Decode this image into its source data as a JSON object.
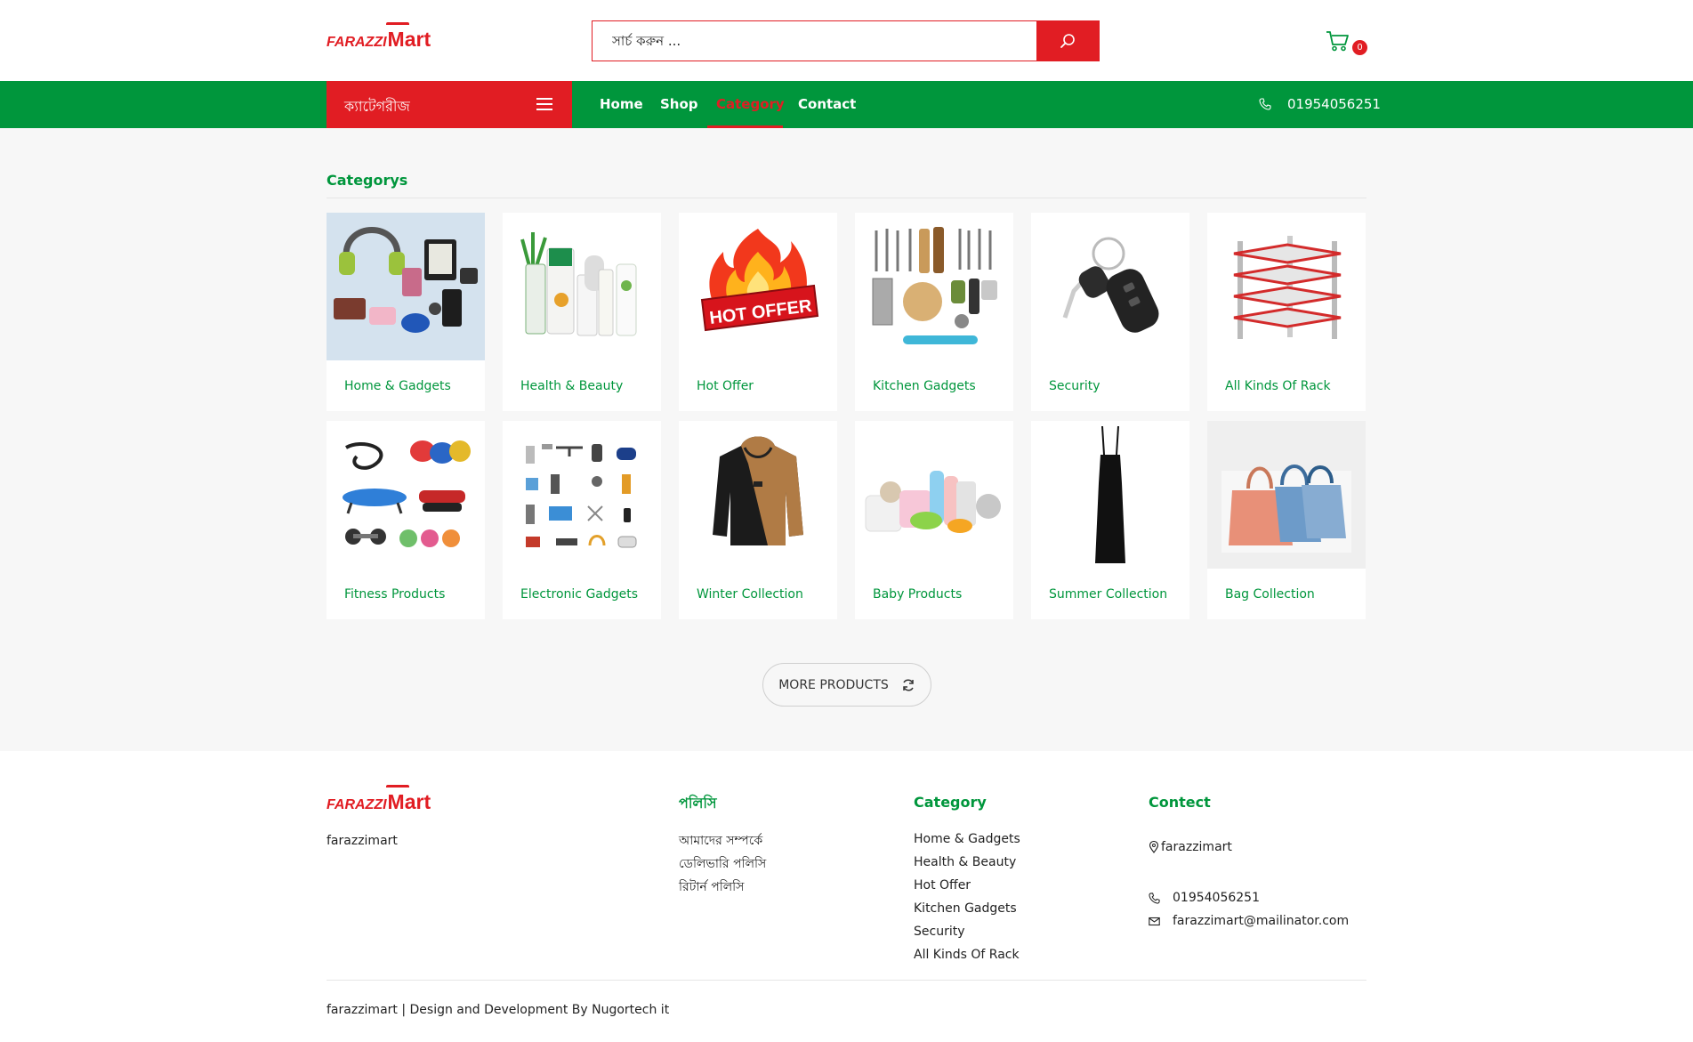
{
  "colors": {
    "brand_green": "#00963c",
    "brand_red": "#e11d23"
  },
  "header": {
    "logo_a": "FARAZZI",
    "logo_b": "Mart",
    "search_placeholder": "সার্চ করুন ...",
    "search_icon": "search-icon",
    "cart_icon": "cart-icon",
    "cart_count": "0"
  },
  "nav": {
    "categories_label": "ক্যাটেগরীজ",
    "links": [
      "Home",
      "Shop",
      "Category",
      "Contact"
    ],
    "active": "Category",
    "phone": "01954056251"
  },
  "main": {
    "title": "Categorys",
    "categories": [
      "Home & Gadgets",
      "Health & Beauty",
      "Hot Offer",
      "Kitchen Gadgets",
      "Security",
      "All Kinds Of Rack",
      "Fitness Products",
      "Electronic Gadgets",
      "Winter Collection",
      "Baby Products",
      "Summer Collection",
      "Bag Collection"
    ],
    "hot_offer_text": "HOT OFFER",
    "more_button": "MORE PRODUCTS"
  },
  "footer": {
    "about": "farazzimart",
    "policy_heading": "পলিসি",
    "policy_links": [
      "আমাদের সম্পর্কে",
      "ডেলিভারি পলিসি",
      "রিটার্ন পলিসি"
    ],
    "category_heading": "Category",
    "category_links": [
      "Home & Gadgets",
      "Health & Beauty",
      "Hot Offer",
      "Kitchen Gadgets",
      "Security",
      "All Kinds Of Rack"
    ],
    "contact_heading": "Contect",
    "address": "farazzimart",
    "phone": "01954056251",
    "email": "farazzimart@mailinator.com",
    "copyright": "farazzimart | Design and Development By Nugortech it"
  }
}
